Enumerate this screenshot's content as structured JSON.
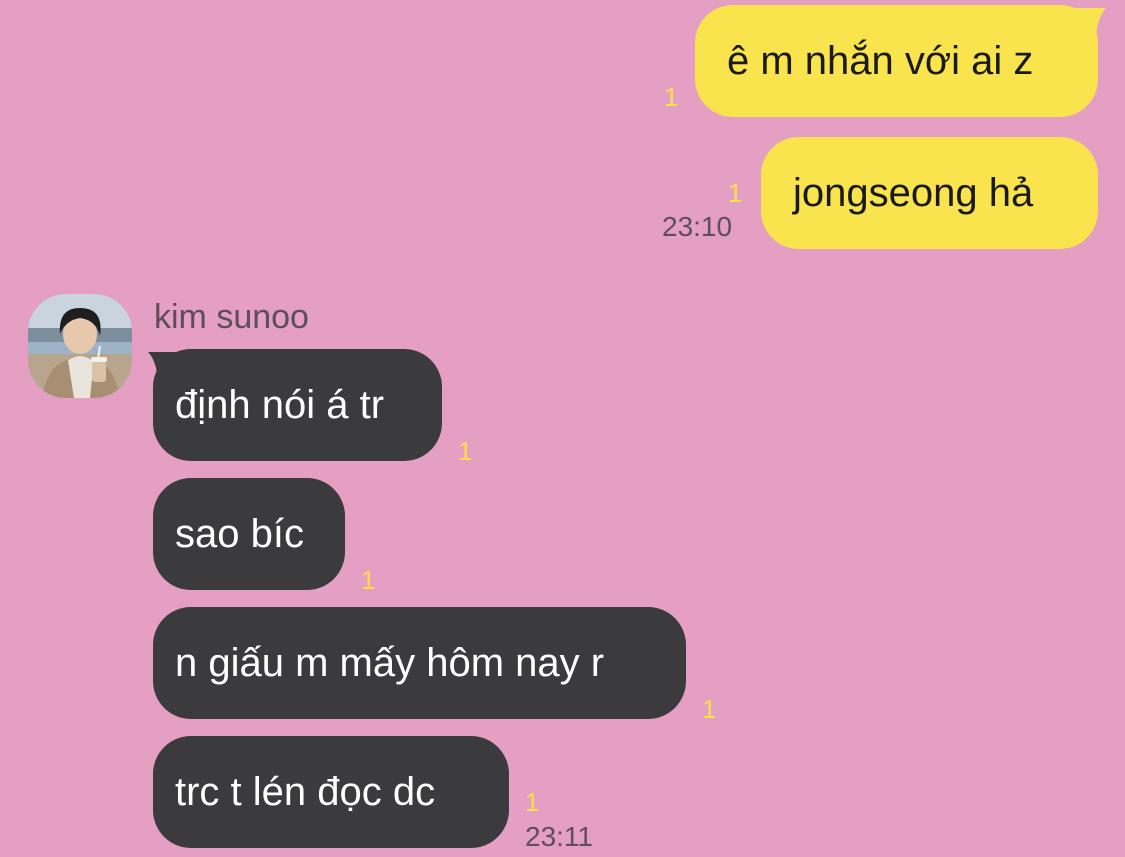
{
  "outgoing": [
    {
      "text": "ê m nhắn với ai z",
      "unread": "1"
    },
    {
      "text": "jongseong hả",
      "unread": "1",
      "time": "23:10"
    }
  ],
  "incoming": {
    "sender": "kim sunoo",
    "messages": [
      {
        "text": "định nói á tr",
        "unread": "1"
      },
      {
        "text": "sao bíc",
        "unread": "1"
      },
      {
        "text": "n giấu m mấy hôm nay r",
        "unread": "1"
      },
      {
        "text": "trc t lén đọc dc",
        "unread": "1",
        "time": "23:11"
      }
    ]
  },
  "colors": {
    "background": "#e49fc2",
    "outgoing_bubble": "#fae44d",
    "incoming_bubble": "#3b3a3c",
    "unread_count": "#f7e04a"
  }
}
